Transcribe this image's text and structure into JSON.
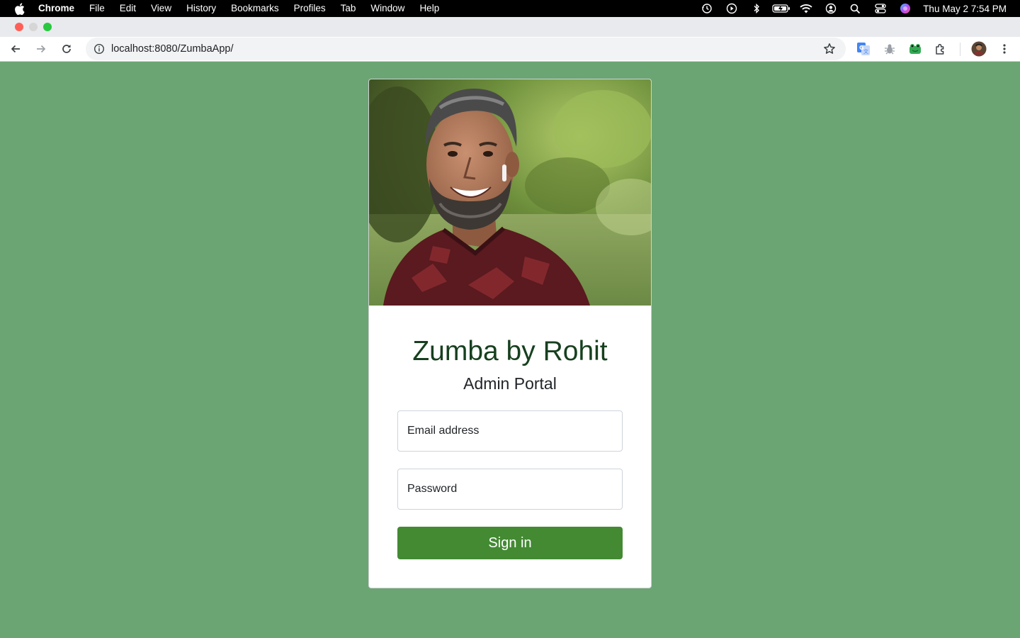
{
  "menubar": {
    "app_name": "Chrome",
    "items": [
      "File",
      "Edit",
      "View",
      "History",
      "Bookmarks",
      "Profiles",
      "Tab",
      "Window",
      "Help"
    ],
    "clock": "Thu May 2  7:54 PM",
    "status_icons": [
      "time-machine-icon",
      "play-icon",
      "bluetooth-icon",
      "battery-icon",
      "wifi-icon",
      "user-icon",
      "spotlight-icon",
      "control-center-icon",
      "siri-icon"
    ]
  },
  "browser": {
    "url": "localhost:8080/ZumbaApp/",
    "extensions": [
      "translate-extension-icon",
      "bug-extension-icon",
      "frog-extension-icon",
      "puzzle-extensions-icon"
    ]
  },
  "login": {
    "title": "Zumba by Rohit",
    "subtitle": "Admin Portal",
    "email_placeholder": "Email address",
    "password_placeholder": "Password",
    "signin_label": "Sign in"
  },
  "colors": {
    "page_background": "#6ba573",
    "title_color": "#17401f",
    "button_color": "#438a33"
  }
}
